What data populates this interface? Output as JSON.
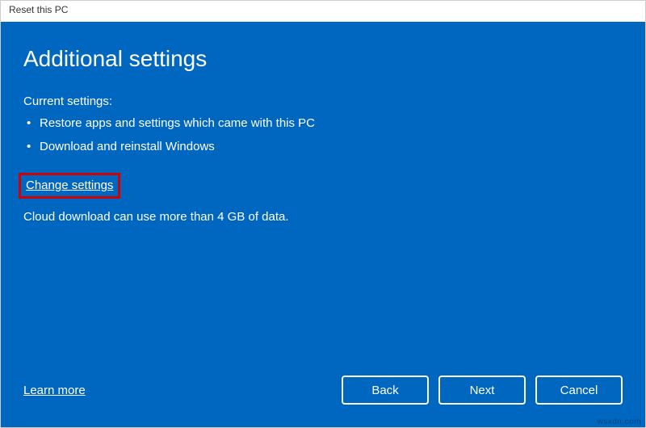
{
  "window": {
    "title": "Reset this PC"
  },
  "page": {
    "heading": "Additional settings",
    "current_settings_label": "Current settings:",
    "settings": [
      "Restore apps and settings which came with this PC",
      "Download and reinstall Windows"
    ],
    "change_settings_link": "Change settings",
    "note": "Cloud download can use more than 4 GB of data."
  },
  "footer": {
    "learn_more": "Learn more",
    "back": "Back",
    "next": "Next",
    "cancel": "Cancel"
  },
  "watermark": "wsxdn.com"
}
